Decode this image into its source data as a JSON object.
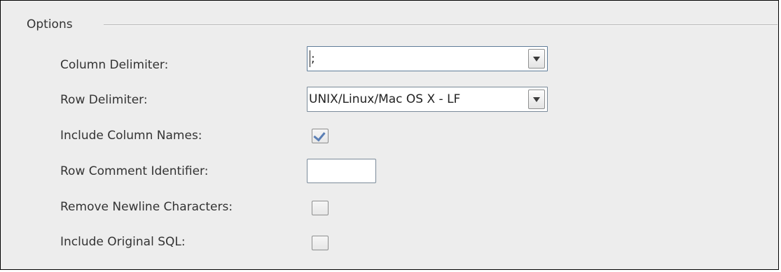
{
  "options_group": {
    "title": "Options"
  },
  "column_delimiter": {
    "label": "Column Delimiter:",
    "value": ";"
  },
  "row_delimiter": {
    "label": "Row Delimiter:",
    "value": "UNIX/Linux/Mac OS X - LF"
  },
  "include_column_names": {
    "label": "Include Column Names:",
    "checked": true
  },
  "row_comment_identifier": {
    "label": "Row Comment Identifier:",
    "value": ""
  },
  "remove_newline_characters": {
    "label": "Remove Newline Characters:",
    "checked": false
  },
  "include_original_sql": {
    "label": "Include Original SQL:",
    "checked": false
  },
  "icons": {
    "dropdown": "chevron-down-icon",
    "check": "checkmark-icon"
  },
  "colors": {
    "panel_background": "#ededed",
    "checkmark": "#5b7fb5",
    "field_border": "#7a8a99"
  }
}
